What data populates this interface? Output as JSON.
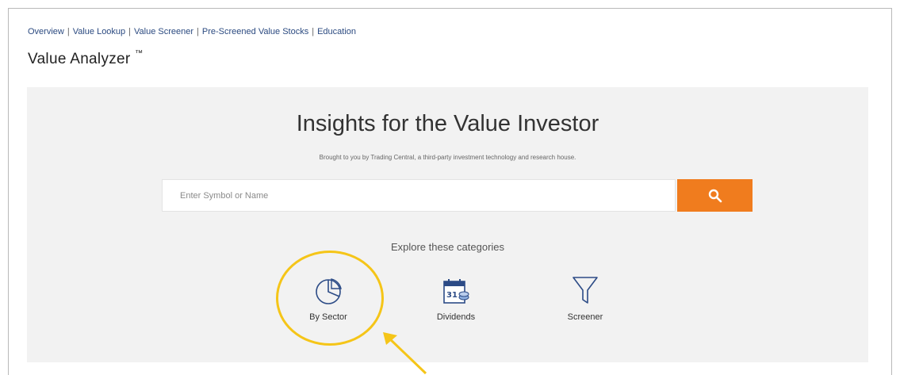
{
  "nav": {
    "items": [
      "Overview",
      "Value Lookup",
      "Value Screener",
      "Pre-Screened Value Stocks",
      "Education"
    ],
    "separator": "|"
  },
  "page": {
    "title": "Value Analyzer",
    "trademark": "™"
  },
  "hero": {
    "heading": "Insights for the Value Investor",
    "subtitle": "Brought to you by Trading Central, a third-party investment technology and research house."
  },
  "search": {
    "placeholder": "Enter Symbol or Name",
    "value": "",
    "button_icon": "search-icon"
  },
  "explore": {
    "label": "Explore these categories",
    "categories": [
      {
        "label": "By Sector",
        "icon": "pie-chart-icon"
      },
      {
        "label": "Dividends",
        "icon": "calendar-dividend-icon",
        "icon_text": "31"
      },
      {
        "label": "Screener",
        "icon": "filter-funnel-icon"
      }
    ]
  },
  "colors": {
    "accent": "#f07c1e",
    "link": "#2b4a80",
    "icon": "#2c4b86",
    "highlight": "#f5c518",
    "panel_bg": "#f2f2f2"
  }
}
